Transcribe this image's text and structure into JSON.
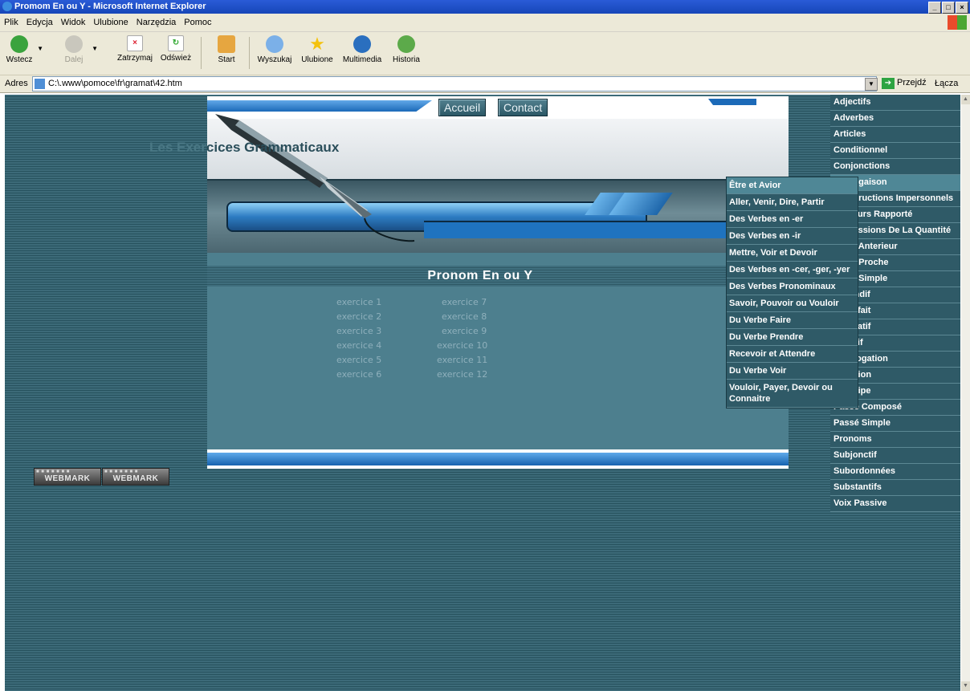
{
  "window": {
    "title": "Promom En ou Y - Microsoft Internet Explorer"
  },
  "menubar": [
    "Plik",
    "Edycja",
    "Widok",
    "Ulubione",
    "Narzędzia",
    "Pomoc"
  ],
  "toolbar": {
    "back": "Wstecz",
    "forward": "Dalej",
    "stop": "Zatrzymaj",
    "refresh": "Odśwież",
    "home": "Start",
    "search": "Wyszukaj",
    "favorites": "Ulubione",
    "media": "Multimedia",
    "history": "Historia"
  },
  "address": {
    "label": "Adres",
    "url": "C:\\.www\\pomoce\\fr\\gramat\\42.htm",
    "go": "Przejdź",
    "links": "Łącza"
  },
  "page": {
    "nav": {
      "home": "Accueil",
      "contact": "Contact"
    },
    "site_title_ghost": "Les Exer",
    "site_title": "cices Grammaticaux",
    "section_title": "Pronom En ou Y",
    "exercises_left": [
      "exercice 1",
      "exercice 2",
      "exercice 3",
      "exercice 4",
      "exercice 5",
      "exercice 6"
    ],
    "exercises_right": [
      "exercice 7",
      "exercice 8",
      "exercice 9",
      "exercice 10",
      "exercice 11",
      "exercice 12"
    ],
    "webmark": "WEBMARK"
  },
  "right_menu": [
    "Adjectifs",
    "Adverbes",
    "Articles",
    "Conditionnel",
    "Conjonctions",
    "Conjugaison",
    "Constructions Impersonnels",
    "Discours Rapporté",
    "Expressions De La Quantité",
    "Futur Anterieur",
    "Futur Proche",
    "Futur Simple",
    "Gérondif",
    "Imparfait",
    "Impératif",
    "Infinitif",
    "Interrogation",
    "Négation",
    "Participe",
    "Passé Composé",
    "Passé Simple",
    "Pronoms",
    "Subjonctif",
    "Subordonnées",
    "Substantifs",
    "Voix Passive"
  ],
  "submenu": [
    "Être et Avior",
    "Aller, Venir, Dire, Partir",
    "Des Verbes en -er",
    "Des Verbes en -ir",
    "Mettre, Voir et Devoir",
    "Des Verbes en -cer, -ger, -yer",
    "Des Verbes Pronominaux",
    "Savoir, Pouvoir ou Vouloir",
    "Du Verbe Faire",
    "Du Verbe Prendre",
    "Recevoir et Attendre",
    "Du Verbe Voir",
    "Vouloir, Payer, Devoir ou Connaitre"
  ]
}
